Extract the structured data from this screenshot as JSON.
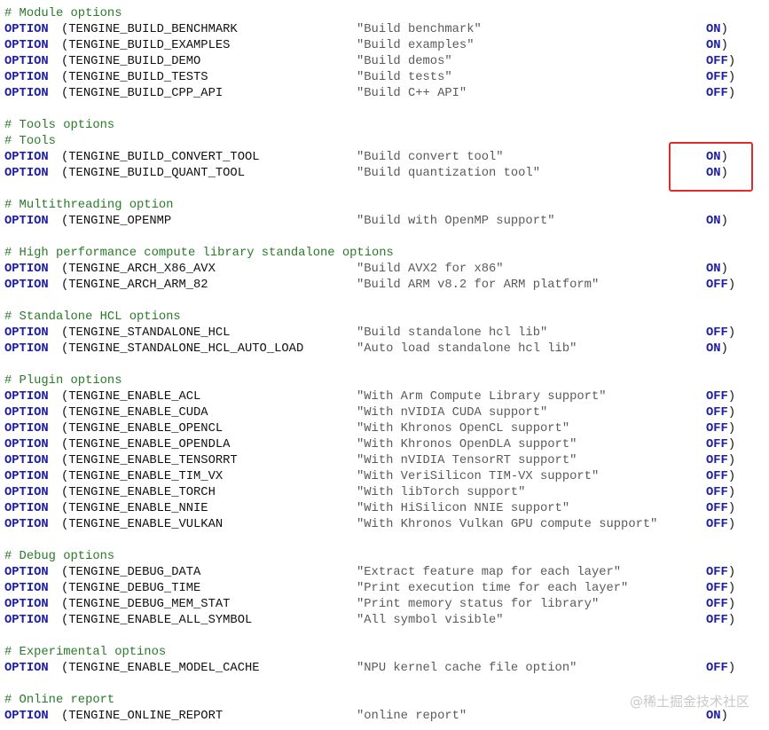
{
  "keyword": "OPTION",
  "sections": [
    {
      "comments": [
        "# Module options"
      ],
      "options": [
        {
          "name": "(TENGINE_BUILD_BENCHMARK",
          "desc": "\"Build benchmark\"",
          "value": "ON",
          "close": ")"
        },
        {
          "name": "(TENGINE_BUILD_EXAMPLES",
          "desc": "\"Build examples\"",
          "value": "ON",
          "close": ")"
        },
        {
          "name": "(TENGINE_BUILD_DEMO",
          "desc": "\"Build demos\"",
          "value": "OFF",
          "close": ")"
        },
        {
          "name": "(TENGINE_BUILD_TESTS",
          "desc": "\"Build tests\"",
          "value": "OFF",
          "close": ")"
        },
        {
          "name": "(TENGINE_BUILD_CPP_API",
          "desc": "\"Build C++ API\"",
          "value": "OFF",
          "close": ")"
        }
      ]
    },
    {
      "comments": [
        "# Tools options",
        "# Tools"
      ],
      "options": [
        {
          "name": "(TENGINE_BUILD_CONVERT_TOOL",
          "desc": "\"Build convert tool\"",
          "value": "ON",
          "close": ")"
        },
        {
          "name": "(TENGINE_BUILD_QUANT_TOOL",
          "desc": "\"Build quantization tool\"",
          "value": "ON",
          "close": ")"
        }
      ]
    },
    {
      "comments": [
        "# Multithreading option"
      ],
      "options": [
        {
          "name": "(TENGINE_OPENMP",
          "desc": "\"Build with OpenMP support\"",
          "value": "ON",
          "close": ")"
        }
      ]
    },
    {
      "comments": [
        "# High performance compute library standalone options"
      ],
      "options": [
        {
          "name": "(TENGINE_ARCH_X86_AVX",
          "desc": "\"Build AVX2 for x86\"",
          "value": "ON",
          "close": ")"
        },
        {
          "name": "(TENGINE_ARCH_ARM_82",
          "desc": "\"Build ARM v8.2 for ARM platform\"",
          "value": "OFF",
          "close": ")"
        }
      ]
    },
    {
      "comments": [
        "# Standalone HCL options"
      ],
      "options": [
        {
          "name": "(TENGINE_STANDALONE_HCL",
          "desc": "\"Build standalone hcl lib\"",
          "value": "OFF",
          "close": ")"
        },
        {
          "name": "(TENGINE_STANDALONE_HCL_AUTO_LOAD",
          "desc": "\"Auto load standalone hcl lib\"",
          "value": "ON",
          "close": ")"
        }
      ]
    },
    {
      "comments": [
        "# Plugin options"
      ],
      "options": [
        {
          "name": "(TENGINE_ENABLE_ACL",
          "desc": "\"With Arm Compute Library support\"",
          "value": "OFF",
          "close": ")"
        },
        {
          "name": "(TENGINE_ENABLE_CUDA",
          "desc": "\"With nVIDIA CUDA support\"",
          "value": "OFF",
          "close": ")"
        },
        {
          "name": "(TENGINE_ENABLE_OPENCL",
          "desc": "\"With Khronos OpenCL support\"",
          "value": "OFF",
          "close": ")"
        },
        {
          "name": "(TENGINE_ENABLE_OPENDLA",
          "desc": "\"With Khronos OpenDLA support\"",
          "value": "OFF",
          "close": ")"
        },
        {
          "name": "(TENGINE_ENABLE_TENSORRT",
          "desc": "\"With nVIDIA TensorRT support\"",
          "value": "OFF",
          "close": ")"
        },
        {
          "name": "(TENGINE_ENABLE_TIM_VX",
          "desc": "\"With VeriSilicon TIM-VX support\"",
          "value": "OFF",
          "close": ")"
        },
        {
          "name": "(TENGINE_ENABLE_TORCH",
          "desc": "\"With libTorch support\"",
          "value": "OFF",
          "close": ")"
        },
        {
          "name": "(TENGINE_ENABLE_NNIE",
          "desc": "\"With HiSilicon NNIE support\"",
          "value": "OFF",
          "close": ")"
        },
        {
          "name": "(TENGINE_ENABLE_VULKAN",
          "desc": "\"With Khronos Vulkan GPU compute support\"",
          "value": "OFF",
          "close": ")"
        }
      ]
    },
    {
      "comments": [
        "# Debug options"
      ],
      "options": [
        {
          "name": "(TENGINE_DEBUG_DATA",
          "desc": "\"Extract feature map for each layer\"",
          "value": "OFF",
          "close": ")"
        },
        {
          "name": "(TENGINE_DEBUG_TIME",
          "desc": "\"Print execution time for each layer\"",
          "value": "OFF",
          "close": ")"
        },
        {
          "name": "(TENGINE_DEBUG_MEM_STAT",
          "desc": "\"Print memory status for library\"",
          "value": "OFF",
          "close": ")"
        },
        {
          "name": "(TENGINE_ENABLE_ALL_SYMBOL",
          "desc": "\"All symbol visible\"",
          "value": "OFF",
          "close": ")"
        }
      ]
    },
    {
      "comments": [
        "# Experimental optinos"
      ],
      "options": [
        {
          "name": "(TENGINE_ENABLE_MODEL_CACHE",
          "desc": "\"NPU kernel cache file option\"",
          "value": "OFF",
          "close": ")"
        }
      ]
    },
    {
      "comments": [
        "# Online report"
      ],
      "options": [
        {
          "name": "(TENGINE_ONLINE_REPORT",
          "desc": "\"online report\"",
          "value": "ON",
          "close": ")"
        }
      ]
    }
  ],
  "watermark": "@稀土掘金技术社区",
  "colors": {
    "keyword": "#1e1ea8",
    "comment": "#2a7a2a",
    "string": "#5a5a5a",
    "highlight": "#e02b2b"
  }
}
